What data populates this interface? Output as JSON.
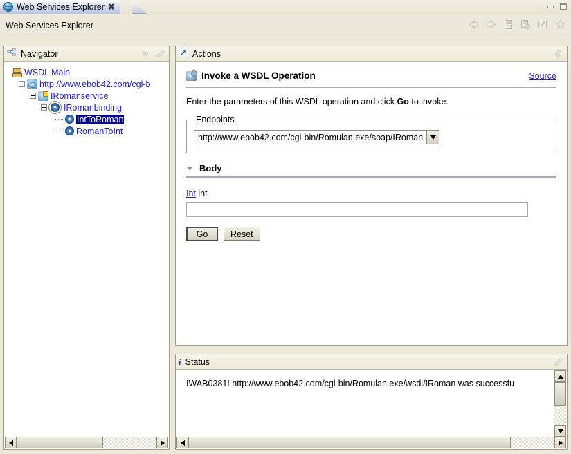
{
  "window": {
    "tab_title": "Web Services Explorer",
    "tab_icon": "globe-icon",
    "close_glyph": "✖",
    "minimize_label": "Minimize",
    "maximize_label": "Maximize"
  },
  "toolbar": {
    "title": "Web Services Explorer",
    "icons": [
      {
        "name": "back-icon",
        "label": "Back"
      },
      {
        "name": "forward-icon",
        "label": "Forward"
      },
      {
        "name": "properties-icon",
        "label": "Properties"
      },
      {
        "name": "web-page-icon",
        "label": "Open Page"
      },
      {
        "name": "launch-icon",
        "label": "Launch"
      },
      {
        "name": "favorite-star-icon",
        "label": "Favorites"
      }
    ]
  },
  "navigator": {
    "title": "Navigator",
    "icon": "navigator-icon",
    "tools": [
      {
        "name": "link-with-editor-icon",
        "label": "Link"
      },
      {
        "name": "maximize-panel-icon",
        "label": "Maximize"
      }
    ],
    "tree": [
      {
        "label": "WSDL Main",
        "icon": "wsdl-main-icon",
        "indent": 0,
        "expander": "none",
        "selected": false
      },
      {
        "label": "http://www.ebob42.com/cgi-b",
        "icon": "wsdl-service-icon",
        "indent": 1,
        "expander": "minus",
        "selected": false
      },
      {
        "label": "IRomanservice",
        "icon": "service-icon",
        "indent": 2,
        "expander": "minus",
        "selected": false
      },
      {
        "label": "IRomanbinding",
        "icon": "binding-gear-icon",
        "indent": 3,
        "expander": "minus",
        "selected": false
      },
      {
        "label": "IntToRoman",
        "icon": "operation-gear-icon",
        "indent": 4,
        "expander": "dots",
        "selected": true
      },
      {
        "label": "RomanToInt",
        "icon": "operation-gear-icon",
        "indent": 4,
        "expander": "dots",
        "selected": false
      }
    ],
    "hscroll": {
      "thumb_percent": 62
    }
  },
  "actions": {
    "title": "Actions",
    "icon": "actions-icon",
    "tool_icon": "maximize-panel-icon",
    "heading": "Invoke a WSDL Operation",
    "heading_icon": "invoke-operation-icon",
    "source_link": "Source",
    "intro_prefix": "Enter the parameters of this WSDL operation and click ",
    "intro_bold": "Go",
    "intro_suffix": " to invoke.",
    "endpoints": {
      "legend": "Endpoints",
      "selected": "http://www.ebob42.com/cgi-bin/Romulan.exe/soap/IRoman",
      "options": [
        "http://www.ebob42.com/cgi-bin/Romulan.exe/soap/IRoman"
      ]
    },
    "body_section": {
      "label": "Body",
      "expanded": true,
      "param_link": "Int",
      "param_type": "int",
      "param_value": "",
      "param_placeholder": ""
    },
    "buttons": {
      "go": "Go",
      "reset": "Reset"
    },
    "hscroll": {
      "thumb_percent": 88
    }
  },
  "status": {
    "title": "Status",
    "icon": "info-icon",
    "tool_icon": "maximize-panel-icon",
    "message": "IWAB0381I http://www.ebob42.com/cgi-bin/Romulan.exe/wsdl/IRoman was successfu",
    "vscroll": {
      "thumb_percent": 55
    }
  },
  "colors": {
    "window_chrome": "#ece9d8",
    "panel_border": "#9d9b8d",
    "tab_active": "#c6cedd",
    "link_blue": "#2222cc",
    "selection_navy": "#000080",
    "panel_canvas": "#ffffff"
  }
}
